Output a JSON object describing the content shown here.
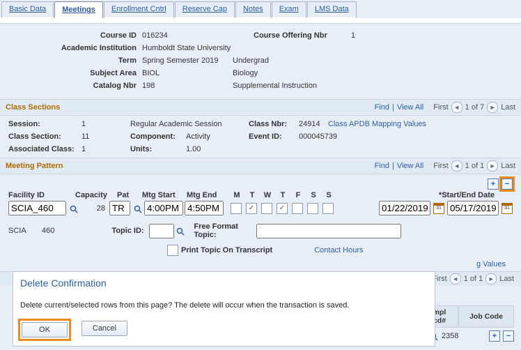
{
  "tabs": {
    "basic_data": "Basic Data",
    "meetings": "Meetings",
    "enrollment_cntrl": "Enrollment Cntrl",
    "reserve_cap": "Reserve Cap",
    "notes": "Notes",
    "exam": "Exam",
    "lms_data": "LMS Data"
  },
  "header": {
    "course_id_label": "Course ID",
    "course_id": "016234",
    "offering_nbr_label": "Course Offering Nbr",
    "offering_nbr": "1",
    "institution_label": "Academic Institution",
    "institution": "Humboldt State University",
    "term_label": "Term",
    "term": "Spring Semester 2019",
    "career": "Undergrad",
    "subject_label": "Subject Area",
    "subject": "BIOL",
    "subject_desc": "Biology",
    "catalog_label": "Catalog Nbr",
    "catalog_nbr": "198",
    "catalog_desc": "Supplemental Instruction"
  },
  "nav": {
    "find": "Find",
    "view_all": "View All",
    "first": "First",
    "last": "Last",
    "sep": "|"
  },
  "class_sections": {
    "title": "Class Sections",
    "counter": "1 of 7",
    "session_label": "Session:",
    "session_value": "1",
    "session_desc": "Regular Academic Session",
    "class_nbr_label": "Class Nbr:",
    "class_nbr": "24914",
    "apdb_link": "Class APDB Mapping Values",
    "class_section_label": "Class Section:",
    "class_section": "11",
    "component_label": "Component:",
    "component": "Activity",
    "event_id_label": "Event ID:",
    "event_id": "000045739",
    "assoc_class_label": "Associated Class:",
    "assoc_class": "1",
    "units_label": "Units:",
    "units": "1.00"
  },
  "meeting_pattern": {
    "title": "Meeting Pattern",
    "counter": "1 of 1",
    "facility_id_label": "Facility ID",
    "capacity_label": "Capacity",
    "pat_label": "Pat",
    "mtg_start_label": "Mtg Start",
    "mtg_end_label": "Mtg End",
    "days_labels": [
      "M",
      "T",
      "W",
      "T",
      "F",
      "S",
      "S"
    ],
    "start_end_label": "*Start/End Date",
    "facility_id": "SCIA_460",
    "capacity": "28",
    "pat": "TR",
    "mtg_start": "4:00PM",
    "mtg_end": "4:50PM",
    "days_checked": [
      false,
      true,
      false,
      true,
      false,
      false,
      false
    ],
    "start_date": "01/22/2019",
    "end_date": "05/17/2019",
    "room_building": "SCIA",
    "room_nbr": "460",
    "topic_id_label": "Topic ID:",
    "topic_id": "",
    "free_format_label": "Free Format Topic:",
    "free_format": "",
    "print_topic_label": "Print Topic On Transcript",
    "contact_hours": "Contact Hours",
    "meeting_apdb_link": "g Values"
  },
  "instructors": {
    "counter": "1 of 1",
    "headers": {
      "empl": "mpl\ncd#",
      "job_code": "Job Code",
      "nbr": "2358"
    }
  },
  "dialog": {
    "title": "Delete Confirmation",
    "body": "Delete current/selected rows from this page? The delete will occur when the transaction is saved.",
    "ok": "OK",
    "cancel": "Cancel"
  }
}
